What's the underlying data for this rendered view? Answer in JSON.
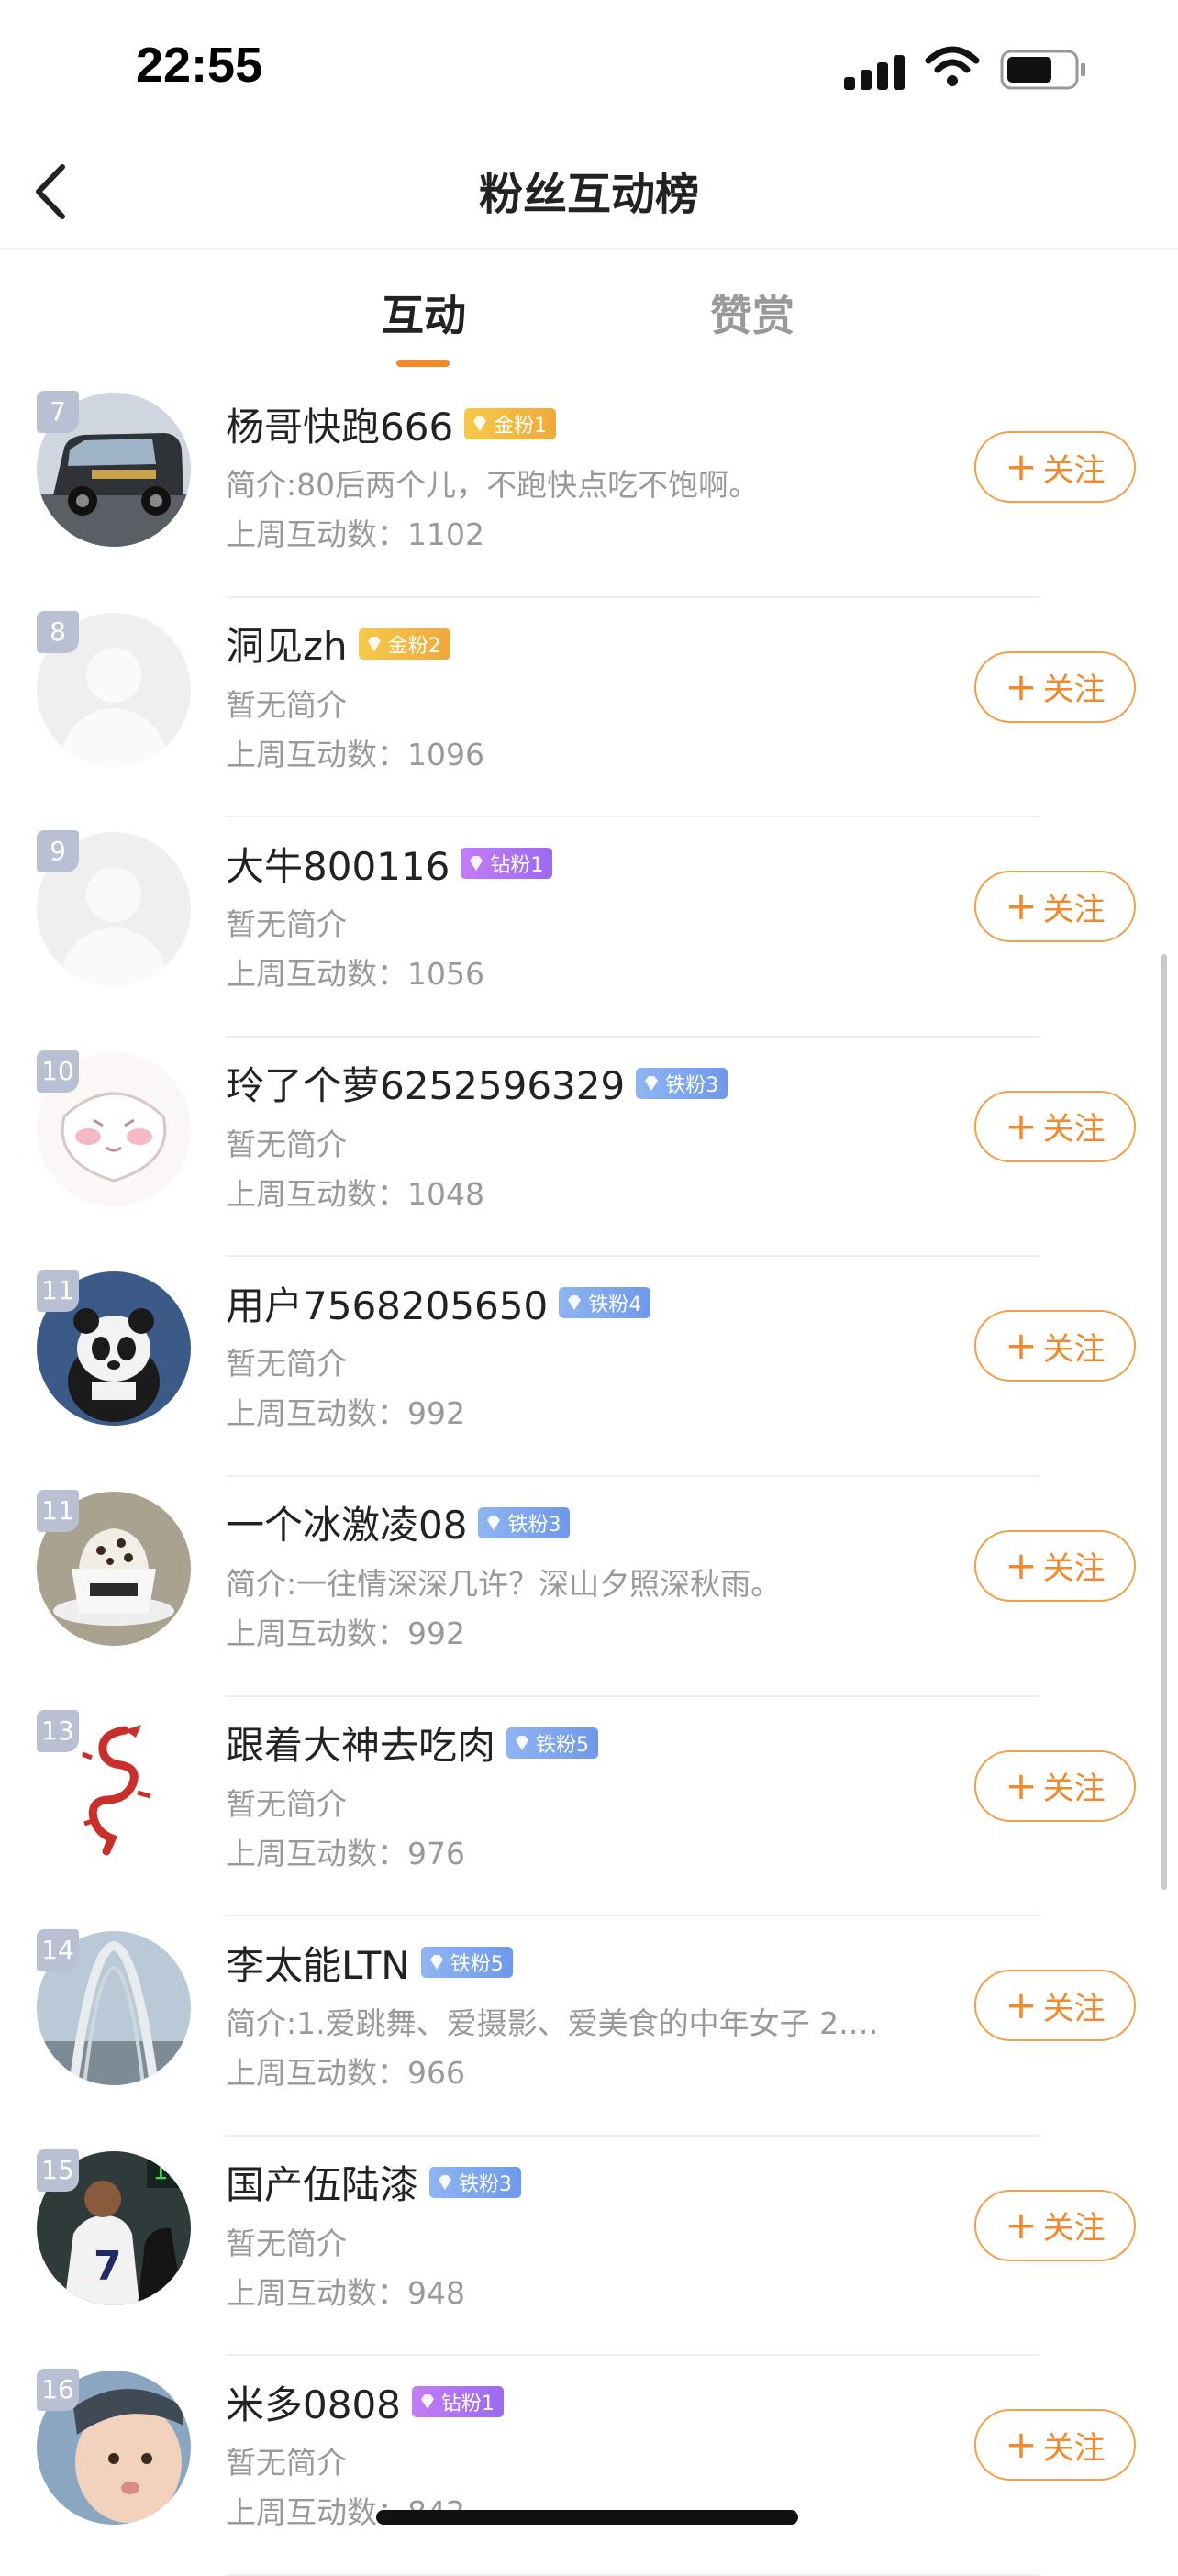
{
  "status_bar": {
    "time": "22:55"
  },
  "header": {
    "title": "粉丝互动榜"
  },
  "tabs": [
    {
      "label": "互动",
      "active": true
    },
    {
      "label": "赞赏",
      "active": false
    }
  ],
  "follow_label": "关注",
  "colors": {
    "accent": "#f08a2c",
    "gold_badge": "#f0a93a",
    "diamond_badge": "#9b6af0",
    "iron_badge": "#6f98ea",
    "rank_badge": "#b9c0d3"
  },
  "fans": [
    {
      "rank": "7",
      "name": "杨哥快跑666",
      "badge": "金粉1",
      "badge_type": "gold",
      "bio": "简介:80后两个儿，不跑快点吃不饱啊。",
      "count": "上周互动数：1102",
      "avatar": "van-avatar"
    },
    {
      "rank": "8",
      "name": "洞见zh",
      "badge": "金粉2",
      "badge_type": "gold",
      "bio": "暂无简介",
      "count": "上周互动数：1096",
      "avatar": "default-avatar"
    },
    {
      "rank": "9",
      "name": "大牛800116",
      "badge": "钻粉1",
      "badge_type": "diamond",
      "bio": "暂无简介",
      "count": "上周互动数：1056",
      "avatar": "default-avatar"
    },
    {
      "rank": "10",
      "name": "玲了个萝6252596329",
      "badge": "铁粉3",
      "badge_type": "iron",
      "bio": "暂无简介",
      "count": "上周互动数：1048",
      "avatar": "cartoon-avatar"
    },
    {
      "rank": "11",
      "name": "用户7568205650",
      "badge": "铁粉4",
      "badge_type": "iron",
      "bio": "暂无简介",
      "count": "上周互动数：992",
      "avatar": "panda-avatar"
    },
    {
      "rank": "11",
      "name": "一个冰激凌08",
      "badge": "铁粉3",
      "badge_type": "iron",
      "bio": "简介:一往情深深几许？深山夕照深秋雨。",
      "count": "上周互动数：992",
      "avatar": "coffee-avatar"
    },
    {
      "rank": "13",
      "name": "跟着大神去吃肉",
      "badge": "铁粉5",
      "badge_type": "iron",
      "bio": "暂无简介",
      "count": "上周互动数：976",
      "avatar": "dragon-avatar"
    },
    {
      "rank": "14",
      "name": "李太能LTN",
      "badge": "铁粉5",
      "badge_type": "iron",
      "bio": "简介:1.爱跳舞、爱摄影、爱美食的中年女子 2.…",
      "count": "上周互动数：966",
      "avatar": "bridge-avatar"
    },
    {
      "rank": "15",
      "name": "国产伍陆漆",
      "badge": "铁粉3",
      "badge_type": "iron",
      "bio": "暂无简介",
      "count": "上周互动数：948",
      "avatar": "football-avatar"
    },
    {
      "rank": "16",
      "name": "米多0808",
      "badge": "钻粉1",
      "badge_type": "diamond",
      "bio": "暂无简介",
      "count": "上周互动数：842",
      "avatar": "baby-avatar"
    }
  ]
}
